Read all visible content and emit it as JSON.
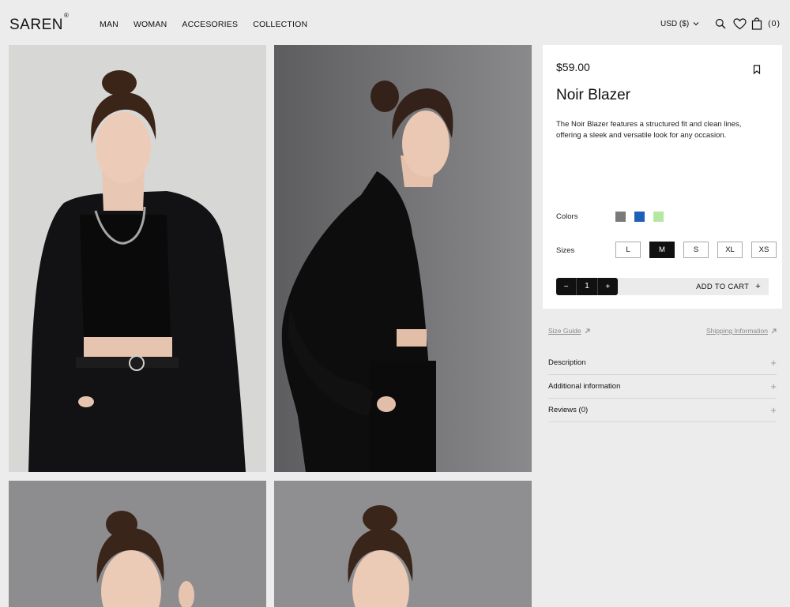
{
  "brand": {
    "name": "SAREN",
    "mark": "®"
  },
  "nav": {
    "items": [
      {
        "label": "MAN"
      },
      {
        "label": "WOMAN"
      },
      {
        "label": "ACCESORIES"
      },
      {
        "label": "COLLECTION"
      }
    ]
  },
  "header": {
    "currency": "USD ($)",
    "cart_count": "(0)",
    "icons": [
      "search-icon",
      "heart-icon",
      "bag-icon",
      "chevron-down-icon"
    ]
  },
  "product": {
    "price": "$59.00",
    "title": "Noir Blazer",
    "description": "The Noir Blazer features a structured fit and clean lines, offering a sleek and versatile look for any occasion.",
    "colors_label": "Colors",
    "colors": [
      "#7a7a7a",
      "#1f5fb8",
      "#b6e7a2"
    ],
    "sizes_label": "Sizes",
    "sizes": [
      "L",
      "M",
      "S",
      "XL",
      "XS"
    ],
    "selected_size": "M",
    "quantity": "1",
    "qty_minus": "−",
    "qty_plus": "+",
    "add_to_cart": "ADD TO CART",
    "add_to_cart_icon": "+"
  },
  "links": {
    "size_guide": "Size Guide",
    "shipping": "Shipping Information"
  },
  "accordion": [
    {
      "label": "Description",
      "icon": "+"
    },
    {
      "label": "Additional information",
      "icon": "+"
    },
    {
      "label": "Reviews (0)",
      "icon": "+"
    }
  ],
  "gallery": {
    "backgrounds": [
      "#d9d9d9",
      "#6f6f72",
      "#8b8b8e",
      "#8d8d90"
    ]
  }
}
